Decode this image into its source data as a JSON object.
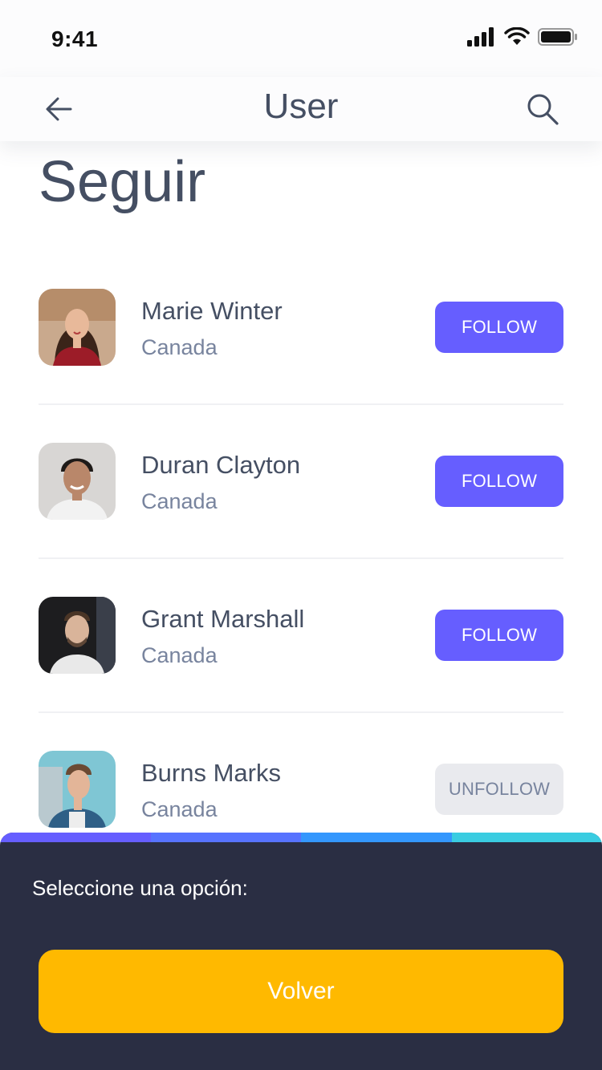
{
  "status_bar": {
    "time": "9:41",
    "signal_icon": "cellular-signal-icon",
    "wifi_icon": "wifi-icon",
    "battery_icon": "battery-icon"
  },
  "nav": {
    "title": "User",
    "back_icon": "arrow-left-icon",
    "search_icon": "search-icon"
  },
  "page": {
    "title": "Seguir"
  },
  "users": [
    {
      "name": "Marie Winter",
      "country": "Canada",
      "action": "FOLLOW",
      "state": "follow"
    },
    {
      "name": "Duran Clayton",
      "country": "Canada",
      "action": "FOLLOW",
      "state": "follow"
    },
    {
      "name": "Grant Marshall",
      "country": "Canada",
      "action": "FOLLOW",
      "state": "follow"
    },
    {
      "name": "Burns Marks",
      "country": "Canada",
      "action": "UNFOLLOW",
      "state": "unfollow"
    }
  ],
  "sheet": {
    "label": "Seleccione una opción:",
    "button_label": "Volver",
    "strip_colors": [
      "#665eff",
      "#5773ff",
      "#3497fd",
      "#3acce1"
    ]
  },
  "colors": {
    "accent": "#665eff",
    "secondary_button": "#e9eaee",
    "sheet_background": "#2a2e43",
    "primary_button": "#ffb900",
    "text_primary": "#454f63",
    "text_secondary": "#78849e"
  }
}
